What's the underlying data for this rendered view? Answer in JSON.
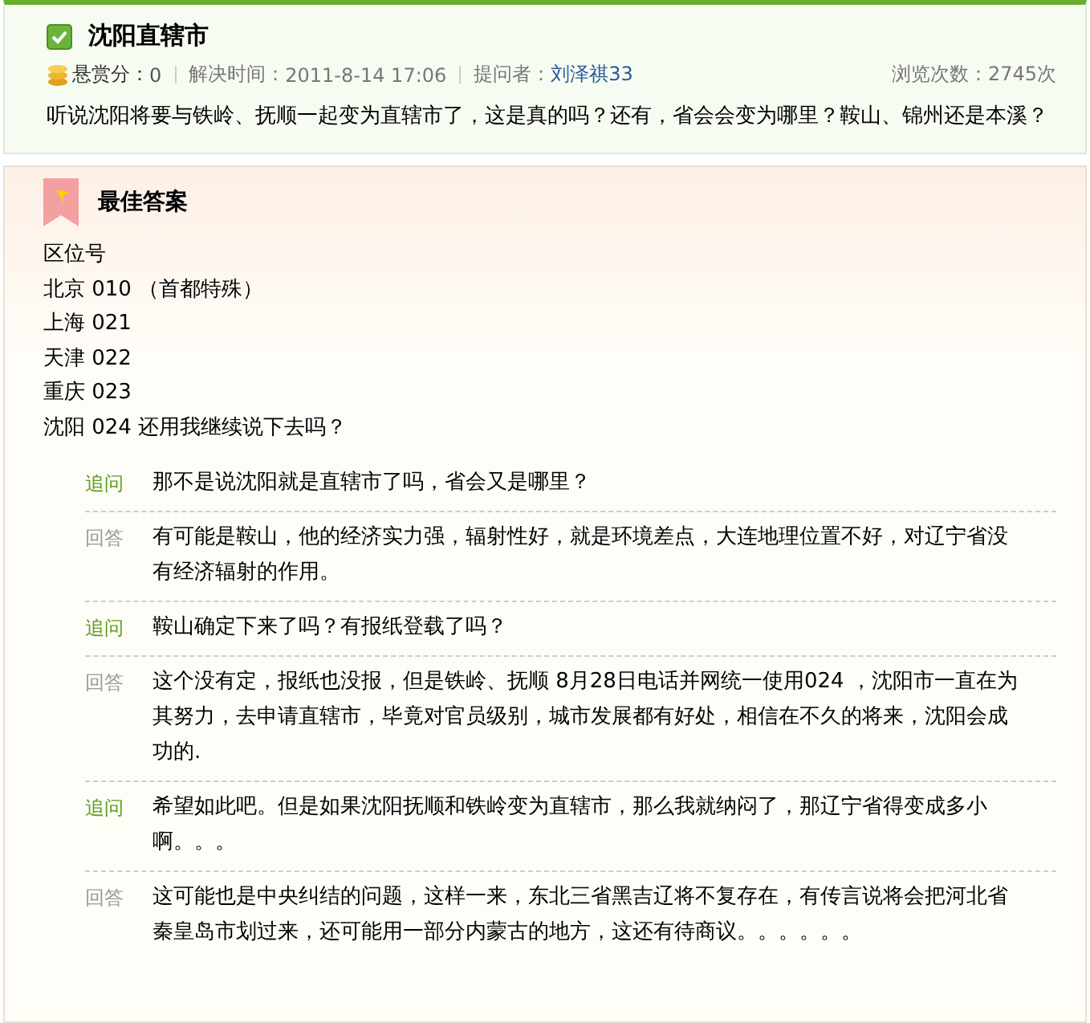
{
  "question": {
    "title": "沈阳直辖市",
    "reward_label": "悬赏分：",
    "reward": "0",
    "solved_label": "解决时间：",
    "solved_time": "2011-8-14 17:06",
    "asker_label": "提问者：",
    "asker": "刘泽祺33",
    "views_label": "浏览次数：",
    "views": "2745次",
    "body": "听说沈阳将要与铁岭、抚顺一起变为直辖市了，这是真的吗？还有，省会会变为哪里？鞍山、锦州还是本溪？"
  },
  "best_answer": {
    "heading": "最佳答案",
    "lines": [
      "区位号",
      "北京 010 （首都特殊）",
      "上海 021",
      "天津 022",
      "重庆 023",
      "沈阳 024  还用我继续说下去吗？"
    ]
  },
  "thread": [
    {
      "kind": "follow_up",
      "label": "追问",
      "text": "那不是说沈阳就是直辖市了吗，省会又是哪里？"
    },
    {
      "kind": "answer",
      "label": "回答",
      "text": "有可能是鞍山，他的经济实力强，辐射性好，就是环境差点，大连地理位置不好，对辽宁省没有经济辐射的作用。"
    },
    {
      "kind": "follow_up",
      "label": "追问",
      "text": "鞍山确定下来了吗？有报纸登载了吗？"
    },
    {
      "kind": "answer",
      "label": "回答",
      "text": "这个没有定，报纸也没报，但是铁岭、抚顺 8月28日电话并网统一使用024 ，沈阳市一直在为其努力，去申请直辖市，毕竟对官员级别，城市发展都有好处，相信在不久的将来，沈阳会成功的."
    },
    {
      "kind": "follow_up",
      "label": "追问",
      "text": "希望如此吧。但是如果沈阳抚顺和铁岭变为直辖市，那么我就纳闷了，那辽宁省得变成多小啊。。。"
    },
    {
      "kind": "answer",
      "label": "回答",
      "text": "这可能也是中央纠结的问题，这样一来，东北三省黑吉辽将不复存在，有传言说将会把河北省秦皇岛市划过来，还可能用一部分内蒙古的地方，这还有待商议。。。。。。"
    }
  ]
}
